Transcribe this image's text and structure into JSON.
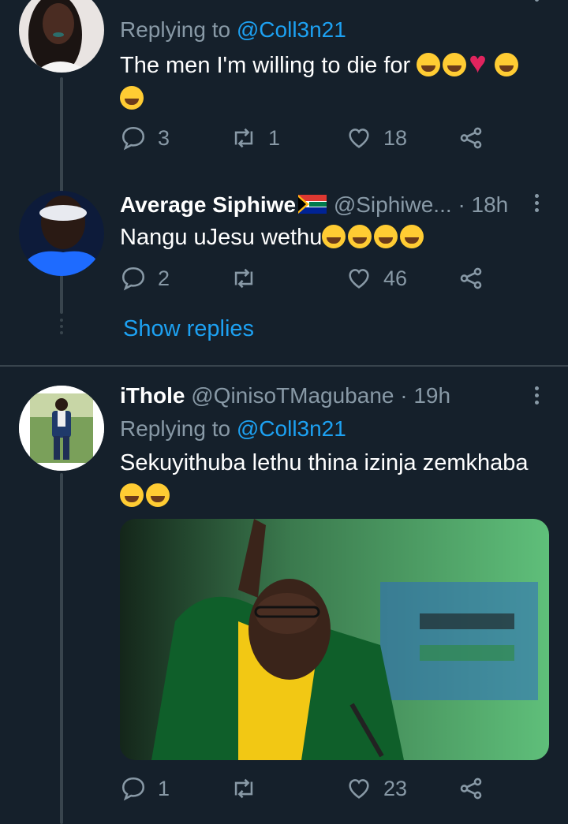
{
  "tweets": [
    {
      "replying_prefix": "Replying to",
      "replying_handle": "@Coll3n21",
      "text": "The men I'm willing to die for",
      "emojis": [
        "joy-crying-emoji",
        "joy-crying-emoji",
        "red-heart-emoji",
        "tears-of-joy-emoji",
        "tears-of-joy-emoji"
      ],
      "replies": "3",
      "retweets": "1",
      "likes": "18"
    },
    {
      "name": "Average Siphiwe",
      "name_badge": "south-africa-flag",
      "handle": "@Siphiwe...",
      "time": "· 18h",
      "text": "Nangu uJesu wethu",
      "emojis": [
        "rofl-emoji",
        "rofl-emoji",
        "rofl-emoji",
        "rofl-emoji"
      ],
      "replies": "2",
      "retweets": "",
      "likes": "46"
    },
    {
      "name": "iThole",
      "handle": "@QinisoTMagubane",
      "time": "· 19h",
      "replying_prefix": "Replying to",
      "replying_handle": "@Coll3n21",
      "text": "Sekuyithuba lethu thina izinja zemkhaba",
      "emojis": [
        "rofl-emoji",
        "rofl-emoji"
      ],
      "media": "photo",
      "replies": "1",
      "retweets": "",
      "likes": "23"
    }
  ],
  "show_replies_label": "Show replies",
  "icons": {
    "reply": "reply-icon",
    "retweet": "retweet-icon",
    "like": "heart-icon",
    "share": "share-icon",
    "more": "more-vertical-icon"
  },
  "colors": {
    "background": "#15202b",
    "secondary_text": "#8899a6",
    "link": "#1da1f2",
    "divider": "#38444d"
  }
}
